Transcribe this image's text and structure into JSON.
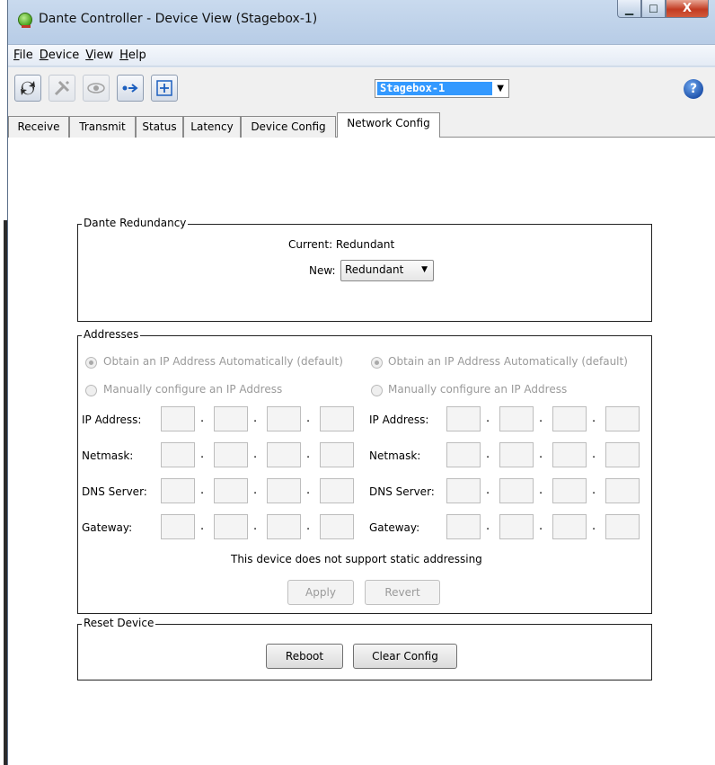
{
  "window": {
    "title": "Dante Controller - Device View (Stagebox-1)",
    "controls": {
      "minimize": "▁",
      "maximize": "☐",
      "close": "X"
    }
  },
  "menu": {
    "items": [
      {
        "mnemonic": "F",
        "rest": "ile"
      },
      {
        "mnemonic": "D",
        "rest": "evice"
      },
      {
        "mnemonic": "V",
        "rest": "iew"
      },
      {
        "mnemonic": "H",
        "rest": "elp"
      }
    ]
  },
  "toolbar": {
    "icons": [
      "refresh-icon",
      "tools-icon",
      "eye-icon",
      "network-icon",
      "add-icon"
    ],
    "device_selected": "Stagebox-1",
    "help_glyph": "?"
  },
  "tabs": [
    "Receive",
    "Transmit",
    "Status",
    "Latency",
    "Device Config",
    "Network Config"
  ],
  "active_tab": "Network Config",
  "redundancy": {
    "title": "Dante Redundancy",
    "current_label": "Current: Redundant",
    "new_label": "New:",
    "new_value": "Redundant"
  },
  "addresses": {
    "title": "Addresses",
    "auto_label": "Obtain an IP Address Automatically (default)",
    "manual_label": "Manually configure an IP Address",
    "fields": [
      "IP Address:",
      "Netmask:",
      "DNS Server:",
      "Gateway:"
    ],
    "note": "This device does not support static addressing",
    "apply": "Apply",
    "revert": "Revert"
  },
  "reset": {
    "title": "Reset Device",
    "reboot": "Reboot",
    "clear": "Clear Config"
  },
  "colors": {
    "titlebar": "#c9daee",
    "selection": "#3399ff",
    "close_button": "#c23b22"
  }
}
